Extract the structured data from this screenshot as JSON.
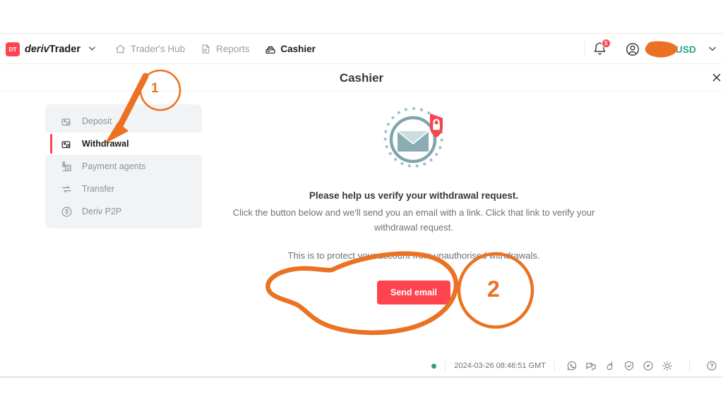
{
  "brand": {
    "logo_text": "DT",
    "name_part1": "deriv",
    "name_part2": "Trader",
    "chevron": "chevron-down"
  },
  "header": {
    "nav": [
      {
        "label": "Trader's Hub",
        "icon": "home-icon",
        "active": false
      },
      {
        "label": "Reports",
        "icon": "report-icon",
        "active": false
      },
      {
        "label": "Cashier",
        "icon": "cashier-icon",
        "active": true
      }
    ],
    "notifications": {
      "icon": "bell-icon",
      "badge": "5"
    },
    "account": {
      "icon": "account-circle-icon"
    },
    "currency": {
      "flag": "us-flag-icon",
      "label": "USD",
      "chevron": "chevron-down-icon"
    }
  },
  "title_bar": {
    "title": "Cashier",
    "close": "close-icon"
  },
  "sidebar": {
    "items": [
      {
        "label": "Deposit",
        "icon": "deposit-icon",
        "active": false
      },
      {
        "label": "Withdrawal",
        "icon": "withdrawal-icon",
        "active": true
      },
      {
        "label": "Payment agents",
        "icon": "payment-agents-icon",
        "active": false
      },
      {
        "label": "Transfer",
        "icon": "transfer-icon",
        "active": false
      },
      {
        "label": "Deriv P2P",
        "icon": "deriv-p2p-icon",
        "active": false
      }
    ]
  },
  "main": {
    "illustration": "email-verification-lock-icon",
    "heading": "Please help us verify your withdrawal request.",
    "body": "Click the button below and we'll send you an email with a link. Click that link to verify your withdrawal request.",
    "note": "This is to protect your account from unauthorised withdrawals.",
    "button_label": "Send email"
  },
  "footer": {
    "status": "online",
    "timestamp": "2024-03-26 08:46:51 GMT",
    "icons": [
      "whatsapp-icon",
      "livechat-icon",
      "deriv-go-icon",
      "shield-icon",
      "responsible-trading-icon",
      "theme-toggle-icon",
      "help-icon"
    ]
  },
  "annotations": [
    {
      "id": "1",
      "label": "1",
      "shape": "circle-with-arrow",
      "target": "sidebar-item-withdrawal",
      "color": "#ea7222"
    },
    {
      "id": "2",
      "label": "2",
      "shape": "circle",
      "target": "send-email-button",
      "color": "#ea7222"
    }
  ],
  "colors": {
    "accent_red": "#ff444f",
    "teal": "#2a9f8f",
    "annotation_orange": "#ea7222",
    "sidebar_bg": "#f2f3f4",
    "text_muted": "#8c9396"
  }
}
